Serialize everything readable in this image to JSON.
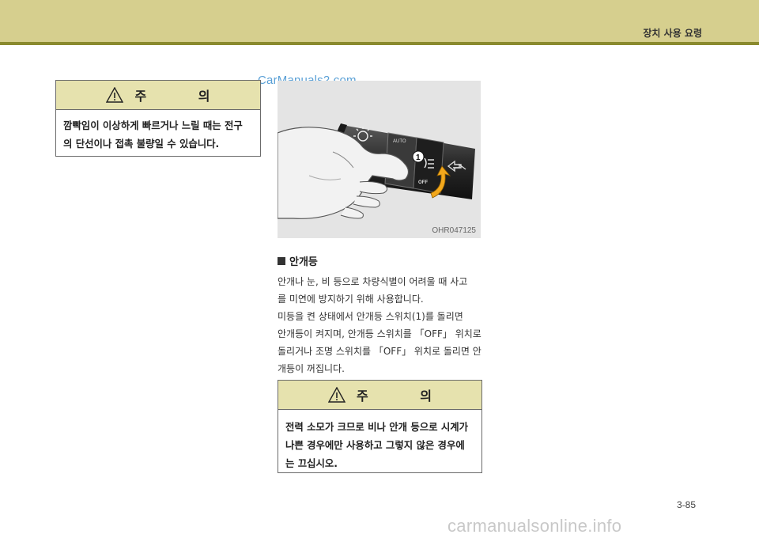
{
  "header": {
    "section_title": "장치 사용 요령",
    "band_color": "#d6cf8e",
    "line_color": "#8a8a2e"
  },
  "watermark_top": "CarManuals2.com",
  "caution_top": {
    "title": "주 의",
    "icon": "warning-triangle-icon",
    "lines": [
      "깜빡임이 이상하게 빠르거나 느릴 때는 전구",
      "의 단선이나 접촉 불량일 수 있습니다."
    ],
    "header_color": "#e6e2ae"
  },
  "figure": {
    "code": "OHR047125",
    "callout_number": "1",
    "switch_labels": [
      "AUTO",
      "OFF"
    ]
  },
  "fog_section": {
    "heading": "안개등",
    "lines": [
      "안개나 눈, 비 등으로 차량식별이 어려울 때 사고",
      "를 미연에 방지하기 위해 사용합니다.",
      "미등을 켠 상태에서 안개등 스위치(1)를 돌리면",
      "안개등이 켜지며, 안개등 스위치를 「OFF」 위치로",
      "돌리거나 조명 스위치를 「OFF」 위치로 돌리면 안",
      "개등이 꺼집니다."
    ]
  },
  "caution_bottom": {
    "title": "주 의",
    "icon": "warning-triangle-icon",
    "lines": [
      "전력 소모가 크므로 비나 안개 등으로 시계가",
      "나쁜 경우에만 사용하고 그렇지 않은 경우에",
      "는 끄십시오."
    ],
    "header_color": "#e6e2ae"
  },
  "page_number": "3-85",
  "footer_watermark": "carmanualsonline.info"
}
